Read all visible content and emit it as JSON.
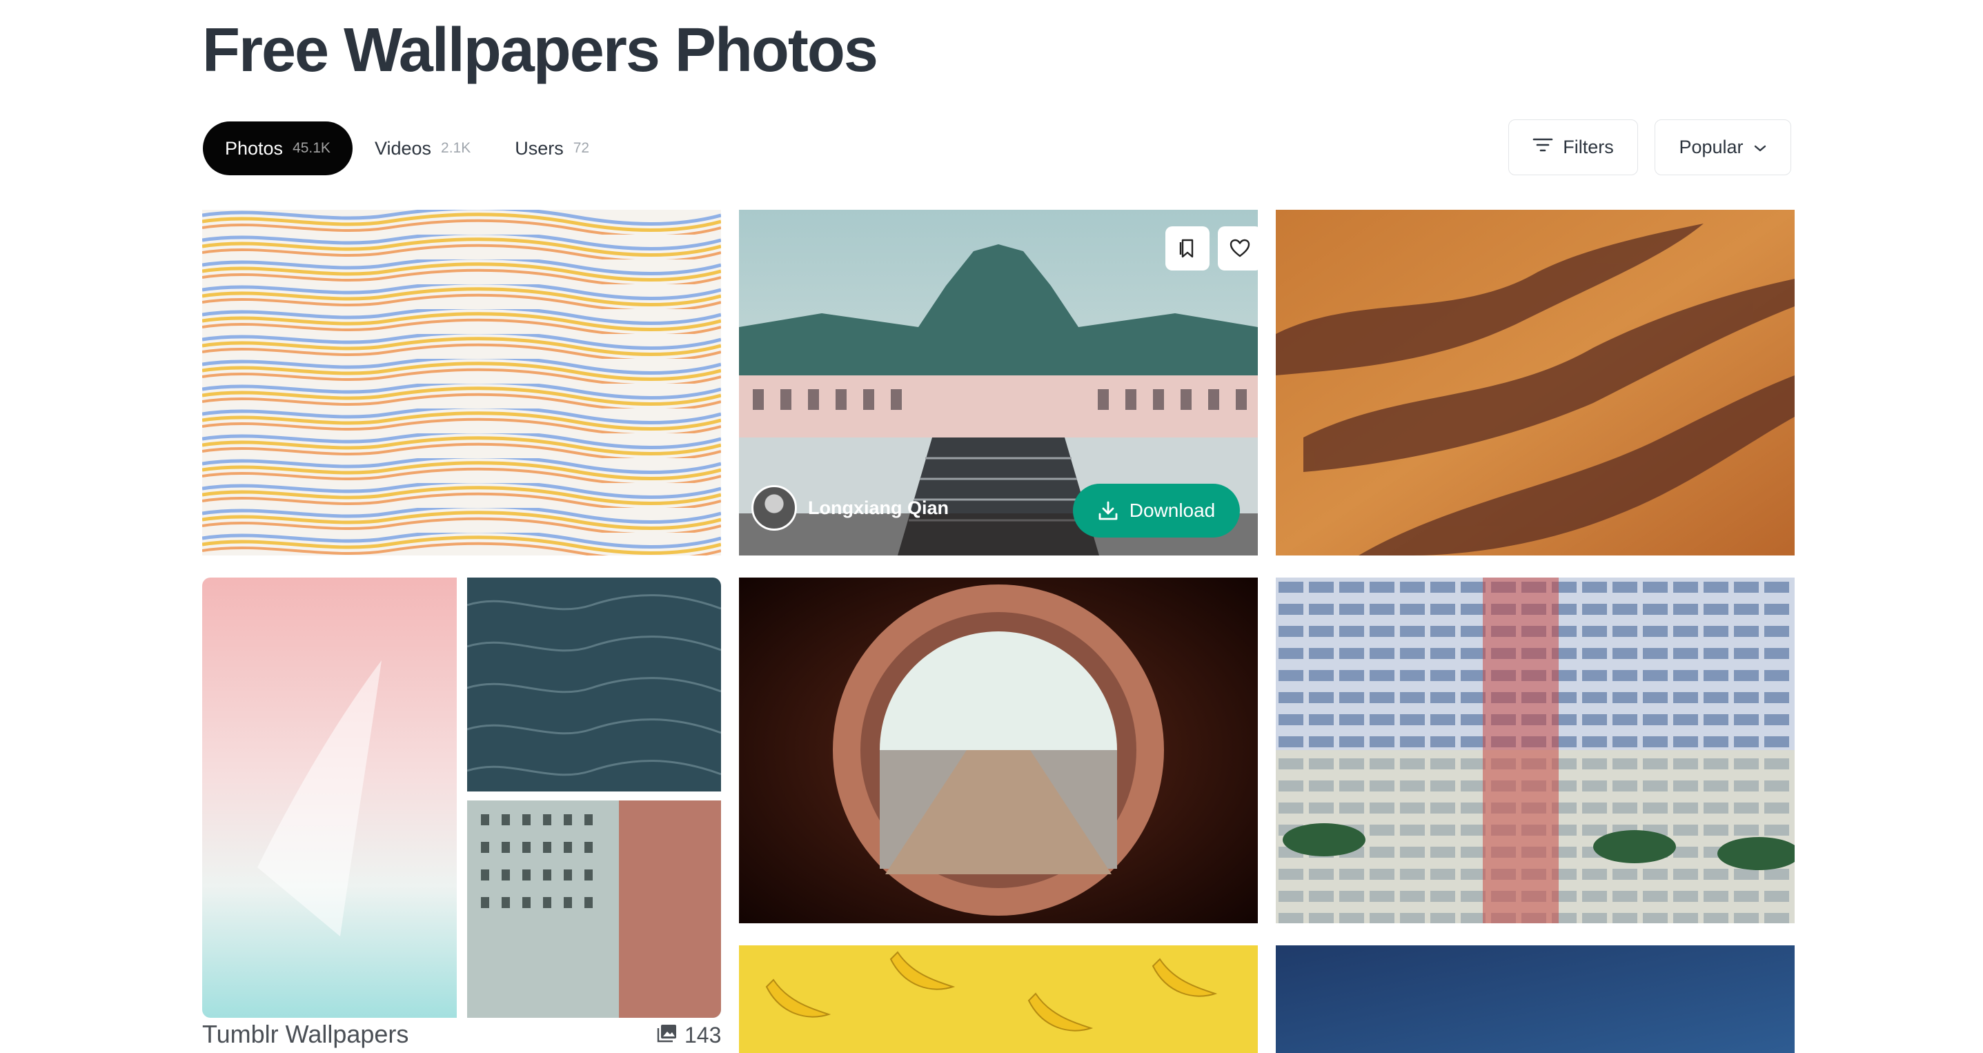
{
  "page": {
    "title": "Free Wallpapers Photos"
  },
  "tabs": [
    {
      "label": "Photos",
      "count": "45.1K"
    },
    {
      "label": "Videos",
      "count": "2.1K"
    },
    {
      "label": "Users",
      "count": "72"
    }
  ],
  "controls": {
    "filters_label": "Filters",
    "sort_value": "Popular"
  },
  "featured": {
    "author": "Longxiang Qian",
    "download_label": "Download"
  },
  "collection": {
    "title": "Tumblr Wallpapers",
    "count": "143"
  },
  "icons": [
    "filter-icon",
    "chevron-down-icon",
    "bookmark-icon",
    "heart-icon",
    "download-icon",
    "gallery-icon"
  ],
  "colors": {
    "accent": "#05a081",
    "active_tab": "#050505"
  }
}
